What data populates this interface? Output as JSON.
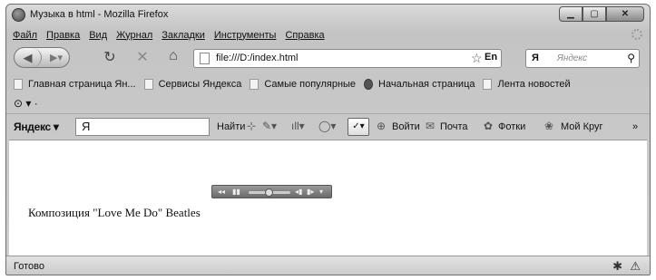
{
  "window": {
    "title": "Музыка в html - Mozilla Firefox"
  },
  "menu": [
    "Файл",
    "Правка",
    "Вид",
    "Журнал",
    "Закладки",
    "Инструменты",
    "Справка"
  ],
  "nav": {
    "url": "file:///D:/index.html",
    "lang_badge": "En",
    "search_engine": "Я",
    "search_placeholder": "Яндекс"
  },
  "bookmarks": [
    "Главная страница Ян...",
    "Сервисы Яндекса",
    "Самые популярные",
    "Начальная страница",
    "Лента новостей"
  ],
  "yandex_bar": {
    "logo": "Яндекс",
    "search_letter": "Я",
    "find": "Найти",
    "login": "Войти",
    "mail": "Почта",
    "photos": "Фотки",
    "my_circle": "Мой Круг"
  },
  "content": {
    "text": "Композиция \"Love Me Do\" Beatles"
  },
  "status": {
    "text": "Готово"
  },
  "icons": {
    "app": "firefox-icon",
    "back": "back-arrow-icon",
    "forward": "forward-arrow-icon",
    "reload": "reload-icon",
    "stop": "stop-icon",
    "home": "home-icon",
    "bookmark_star": "star-icon",
    "search": "search-icon"
  }
}
